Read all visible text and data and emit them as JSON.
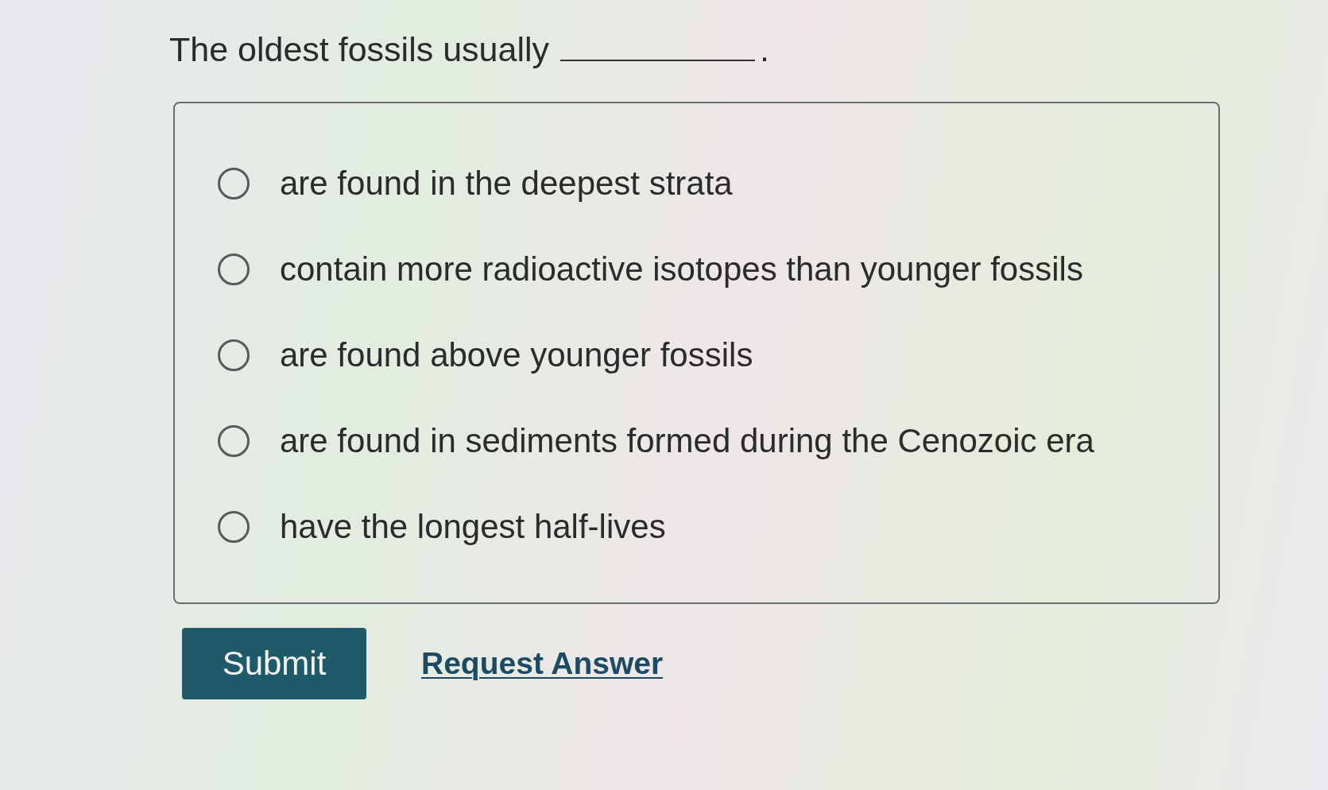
{
  "question": {
    "parts": [
      {
        "kind": "text",
        "text": "The oldest fossils usually"
      },
      {
        "kind": "blank"
      },
      {
        "kind": "text",
        "text": "."
      }
    ]
  },
  "options": [
    {
      "label": "are found in the deepest strata",
      "selected": false
    },
    {
      "label": "contain more radioactive isotopes than younger fossils",
      "selected": false
    },
    {
      "label": "are found above younger fossils",
      "selected": false
    },
    {
      "label": "are found in sediments formed during the Cenozoic era",
      "selected": false
    },
    {
      "label": "have the longest half-lives",
      "selected": false
    }
  ],
  "actions": [
    {
      "kind": "button",
      "label": "Submit"
    },
    {
      "kind": "link",
      "label": "Request Answer"
    }
  ]
}
